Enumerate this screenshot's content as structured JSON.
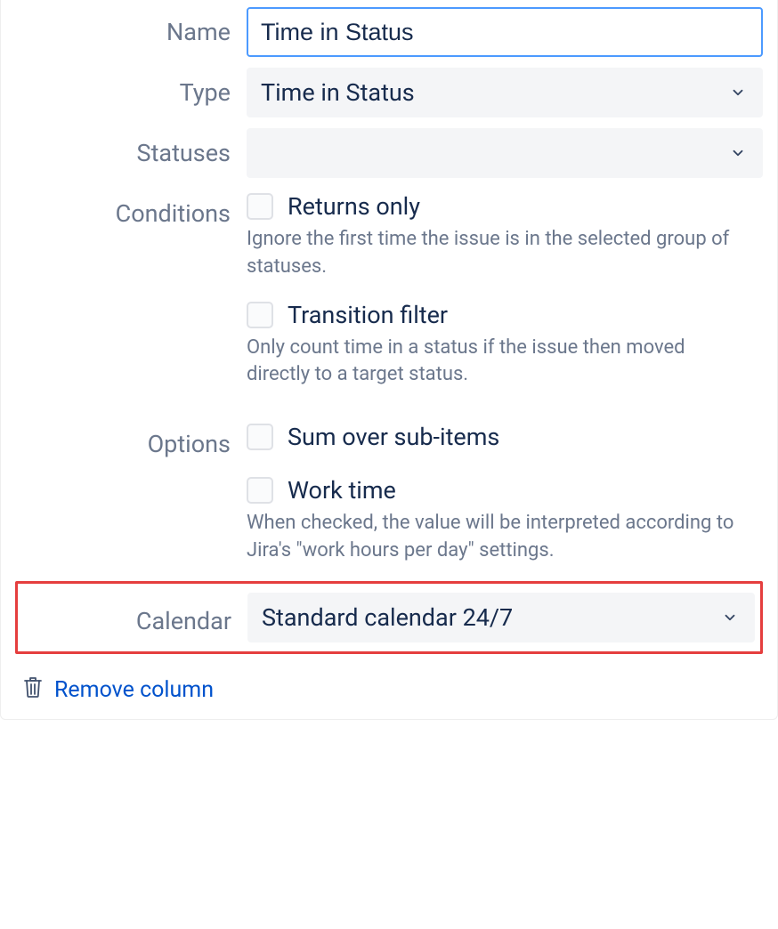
{
  "labels": {
    "name": "Name",
    "type": "Type",
    "statuses": "Statuses",
    "conditions": "Conditions",
    "options": "Options",
    "calendar": "Calendar"
  },
  "fields": {
    "name_value": "Time in Status",
    "type_value": "Time in Status",
    "statuses_value": "",
    "calendar_value": "Standard calendar 24/7"
  },
  "conditions": {
    "returns_only": {
      "label": "Returns only",
      "help": "Ignore the first time the issue is in the selected group of statuses."
    },
    "transition_filter": {
      "label": "Transition filter",
      "help": "Only count time in a status if the issue then moved directly to a target status."
    }
  },
  "options": {
    "sum_sub": {
      "label": "Sum over sub-items"
    },
    "work_time": {
      "label": "Work time",
      "help": "When checked, the value will be interpreted according to Jira's \"work hours per day\" settings."
    }
  },
  "footer": {
    "remove_column": "Remove column"
  }
}
